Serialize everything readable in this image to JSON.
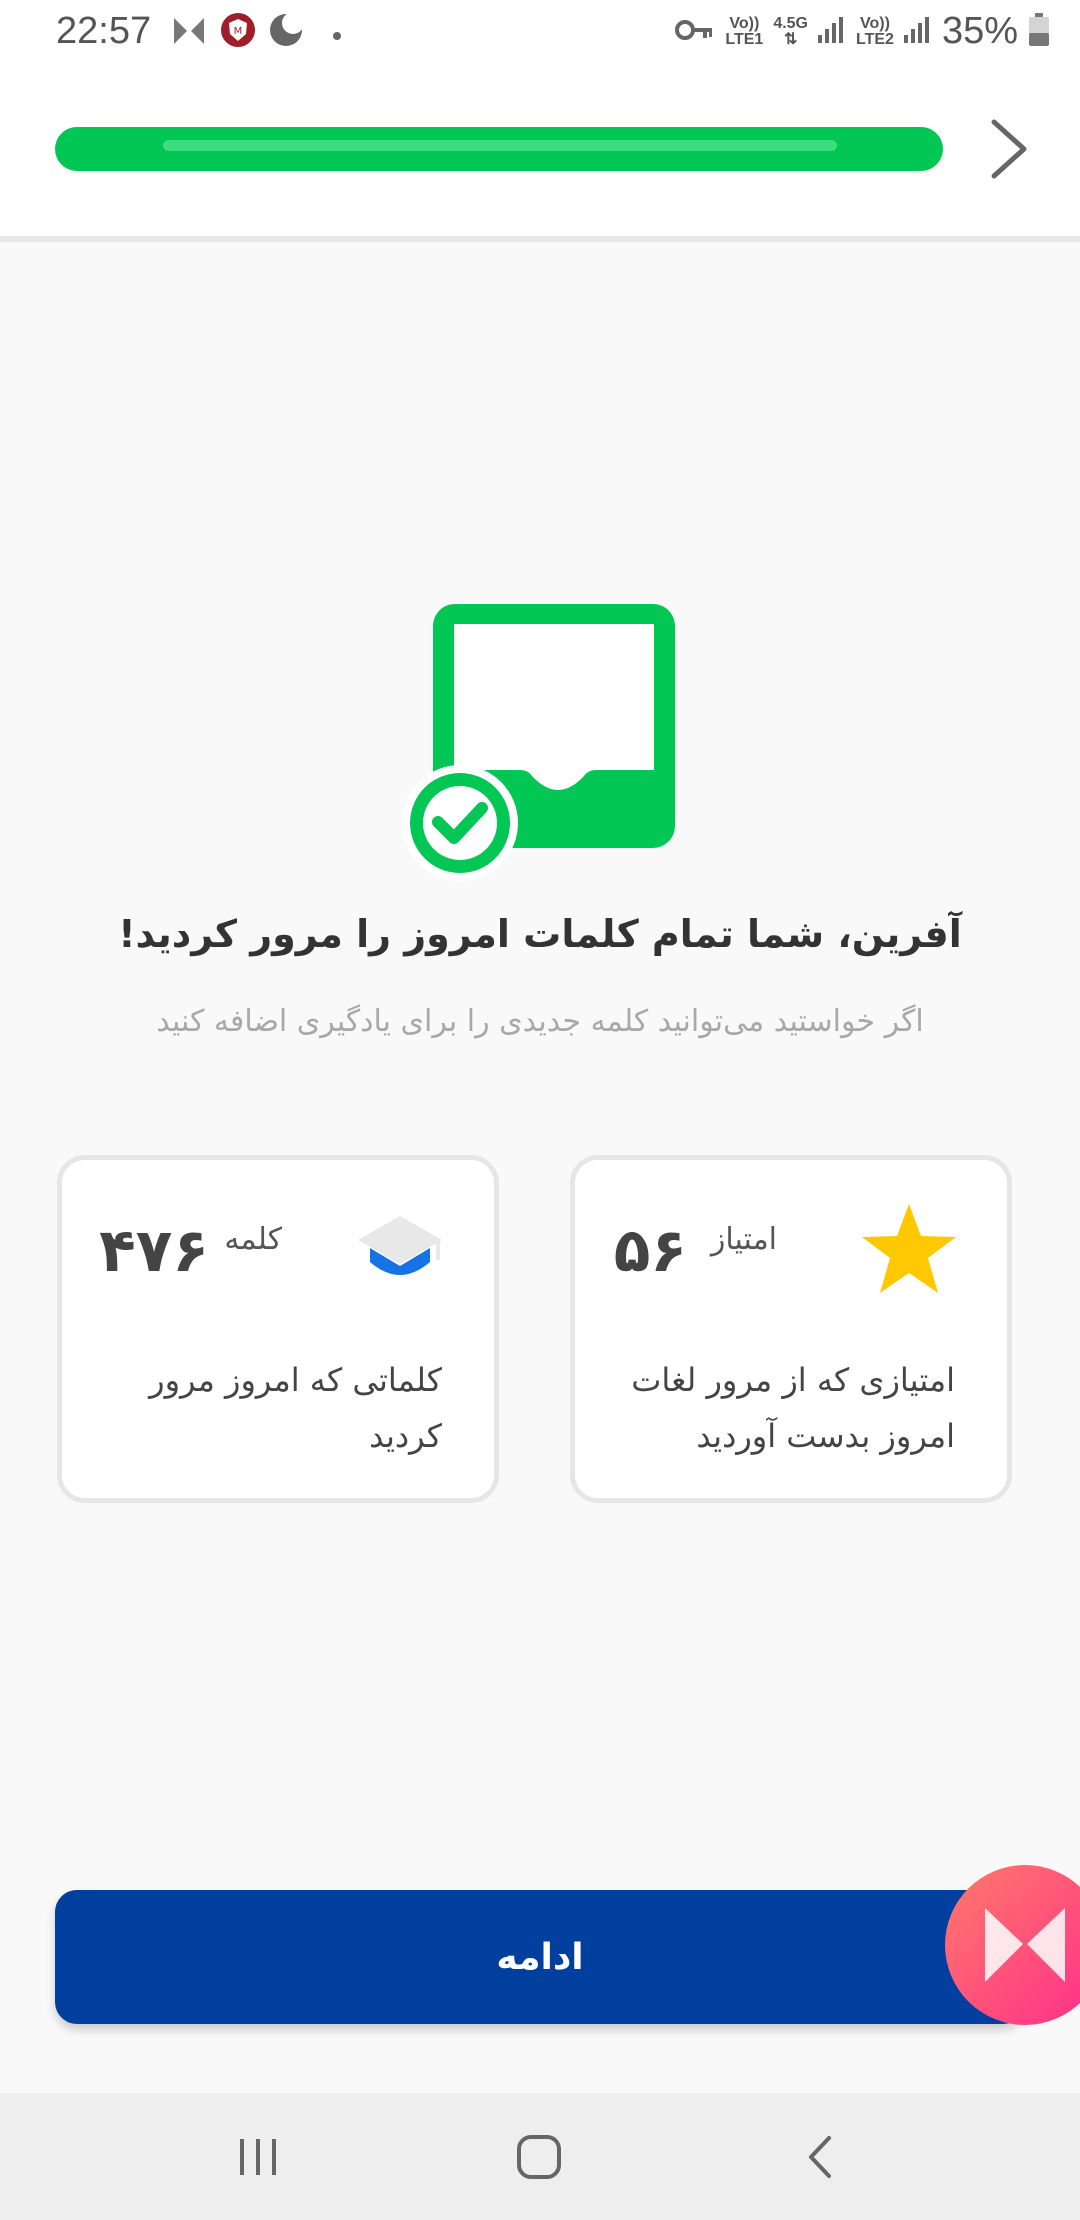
{
  "status_bar": {
    "time": "22:57",
    "battery": "35%",
    "sim1_top": "Vo))",
    "sim1_bottom": "LTE1",
    "network_top": "4.5G",
    "sim2_top": "Vo))",
    "sim2_bottom": "LTE2",
    "icons": [
      "musixmatch-icon",
      "shield-app-icon",
      "moon-icon",
      "dot-icon",
      "key-icon",
      "signal-icon",
      "battery-icon"
    ]
  },
  "header": {
    "progress": 1.0,
    "next_icon": "chevron-right-icon",
    "colors": {
      "bar": "#03c755",
      "bar_shine": "#3ddc7f"
    }
  },
  "main": {
    "illustration_icon": "inbox-check-icon",
    "title": "آفرین، شما تمام کلمات امروز را مرور کردید!",
    "subtitle": "اگر خواستید می‌توانید کلمه جدیدی را برای یادگیری اضافه کنید"
  },
  "cards": {
    "score": {
      "icon": "star-icon",
      "label": "امتیاز",
      "value": "۵۶",
      "description": "امتیازی که از مرور لغات امروز بدست آوردید"
    },
    "words": {
      "icon": "graduation-cap-icon",
      "label": "کلمه",
      "value": "۴۷۶",
      "description": "کلماتی که امروز مرور کردید"
    }
  },
  "continue_button": {
    "label": "ادامه",
    "color": "#003f9e"
  },
  "floating_badge": {
    "icon": "musixmatch-icon"
  },
  "navbar": {
    "items": [
      "recent-apps-icon",
      "home-icon",
      "back-icon"
    ]
  }
}
